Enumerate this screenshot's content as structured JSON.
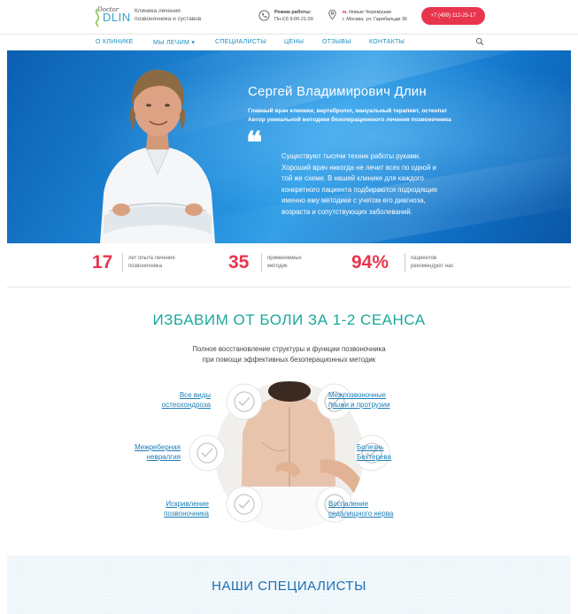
{
  "header": {
    "logo_small": "Doctor",
    "logo_main": "DLIN",
    "tagline_line1": "Клиника лечения",
    "tagline_line2": "позвоночника и суставов",
    "hours_title": "Режим работы:",
    "hours_value": "Пн-Сб 9:00-21:00",
    "metro_prefix": "м.",
    "metro_station": "Новые Черемушки",
    "address": "г. Москва, ул. Гарибальди 36",
    "phone": "+7 (499) 112-25-17"
  },
  "nav": {
    "items": [
      "О КЛИНИКЕ",
      "МЫ ЛЕЧИМ ▾",
      "СПЕЦИАЛИСТЫ",
      "ЦЕНЫ",
      "ОТЗЫВЫ",
      "КОНТАКТЫ"
    ]
  },
  "hero": {
    "name": "Сергей Владимирович Длин",
    "role_line1": "Главный врач клиники, вертебролог, мануальный терапевт, остеопат",
    "role_line2": "Автор уникальной методики безоперационного лечения позвоночника",
    "quote_mark": "❝",
    "quote_lines": [
      "Существуют тысячи техник работы руками.",
      "Хороший врач никогда не лечит всех по одной и",
      "той же схеме. В нашей клинике для каждого",
      "конкретного пациента подбираются подходящие",
      "именно ему методики с учетом его диагноза,",
      "возраста и сопутствующих заболеваний."
    ]
  },
  "stats": [
    {
      "number": "17",
      "line1": "лет опыта лечения",
      "line2": "позвоночника"
    },
    {
      "number": "35",
      "line1": "применяемых",
      "line2": "методик"
    },
    {
      "number": "94%",
      "line1": "пациентов",
      "line2": "рекомендуют нас"
    }
  ],
  "relief": {
    "title": "ИЗБАВИМ ОТ БОЛИ ЗА 1-2 СЕАНСА",
    "subtitle_line1": "Полное восстановление структуры и функции позвоночника",
    "subtitle_line2": "при помощи эффективных безоперационных методик",
    "conditions_left": [
      {
        "line1": "Все виды",
        "line2": "остеохондроза"
      },
      {
        "line1": "Межреберная",
        "line2": "невралгия"
      },
      {
        "line1": "Искривление",
        "line2": "позвоночника"
      }
    ],
    "conditions_right": [
      {
        "line1": "Межпозвоночные",
        "line2": "грыжи и протрузии"
      },
      {
        "line1": "Болезнь",
        "line2": "Бехтерева"
      },
      {
        "line1": "Воспаление",
        "line2": "седалищного нерва"
      }
    ]
  },
  "specialists": {
    "title": "НАШИ СПЕЦИАЛИСТЫ"
  },
  "colors": {
    "accent_red": "#e8354e",
    "link_blue": "#1b8fc2",
    "teal_title": "#1aa99a",
    "hero_blue": "#1e86d6"
  }
}
